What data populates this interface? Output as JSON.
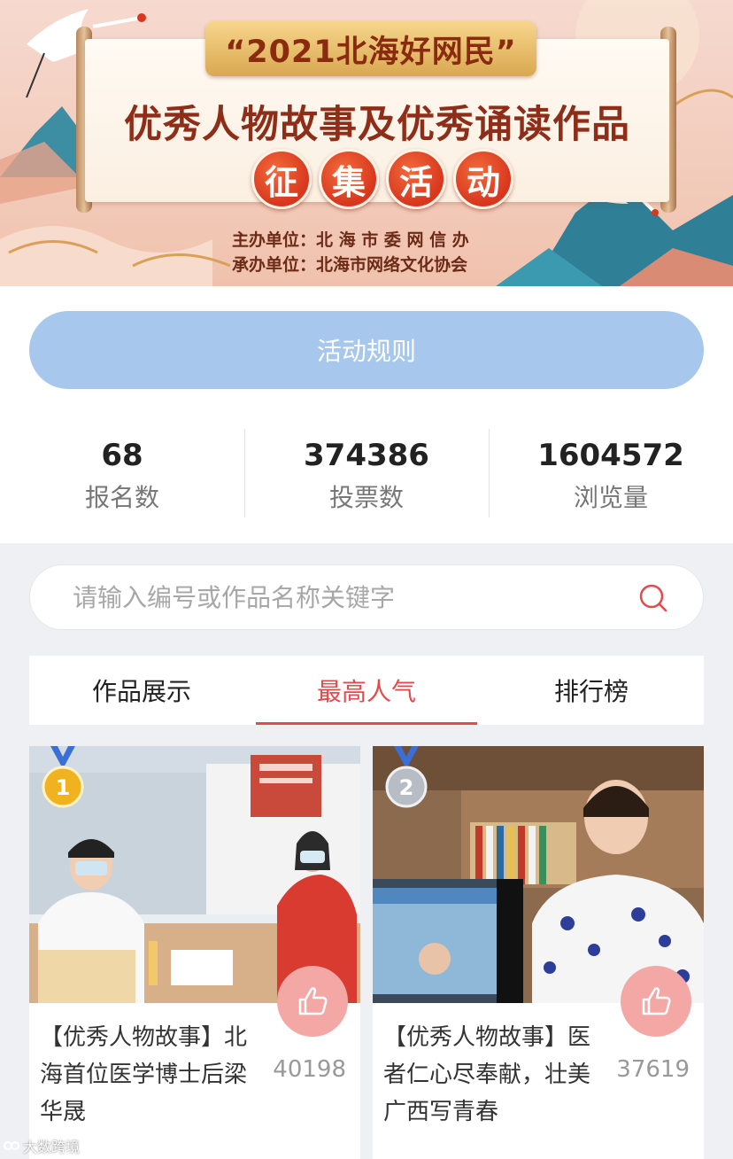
{
  "banner": {
    "year_title": "“2021北海好网民”",
    "main_title": "优秀人物故事及优秀诵读作品",
    "subtitle_chars": [
      "征",
      "集",
      "活",
      "动"
    ],
    "host": "主办单位：北 海 市 委 网 信 办",
    "organizer": "承办单位：北海市网络文化协会"
  },
  "rules_button": "活动规则",
  "stats": [
    {
      "value": "68",
      "label": "报名数"
    },
    {
      "value": "374386",
      "label": "投票数"
    },
    {
      "value": "1604572",
      "label": "浏览量"
    }
  ],
  "search": {
    "placeholder": "请输入编号或作品名称关键字",
    "value": ""
  },
  "tabs": [
    {
      "label": "作品展示",
      "active": false
    },
    {
      "label": "最高人气",
      "active": true
    },
    {
      "label": "排行榜",
      "active": false
    }
  ],
  "cards": [
    {
      "rank": "1",
      "title": "【优秀人物故事】北海首位医学博士后梁华晟",
      "votes": "40198",
      "medal_color": "#f0b21f"
    },
    {
      "rank": "2",
      "title": "【优秀人物故事】医者仁心尽奉献，壮美广西写青春",
      "votes": "37619",
      "medal_color": "#b8bcc4"
    }
  ],
  "watermark": "大数跨境",
  "colors": {
    "accent": "#e4494b",
    "rules_button": "#a7c7ec",
    "like_button": "#f3a8a6"
  },
  "icons": {
    "search": "search-icon",
    "like": "thumbs-up-icon",
    "medal": "medal-icon"
  }
}
